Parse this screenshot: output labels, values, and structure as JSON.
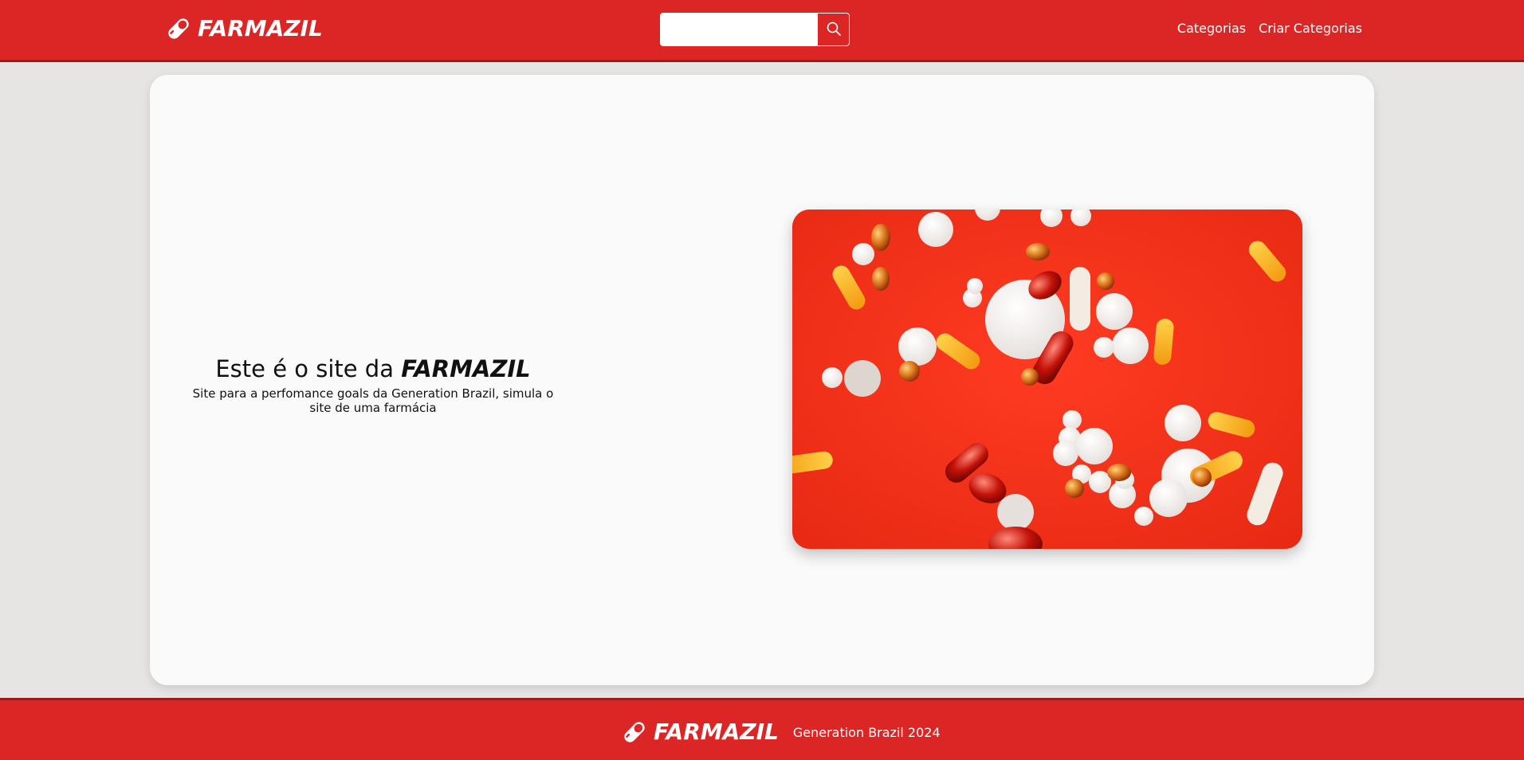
{
  "header": {
    "logo_text": "FARMAZIL",
    "search": {
      "placeholder": "",
      "value": ""
    },
    "nav": [
      {
        "label": "Categorias"
      },
      {
        "label": "Criar Categorias"
      }
    ]
  },
  "hero": {
    "title_prefix": "Este é o site da",
    "title_brand": "FARMAZIL",
    "subtitle": "Site para a perfomance goals da Generation Brazil, simula o site de uma farmácia"
  },
  "footer": {
    "logo_text": "FARMAZIL",
    "copyright": "Generation Brazil 2024"
  },
  "icons": {
    "logo": "pill-icon",
    "search": "search-icon"
  },
  "colors": {
    "brand_red": "#dc2626",
    "brand_red_dark": "#991b1b",
    "page_bg": "#e7e5e4",
    "card_bg": "#fafafa"
  }
}
